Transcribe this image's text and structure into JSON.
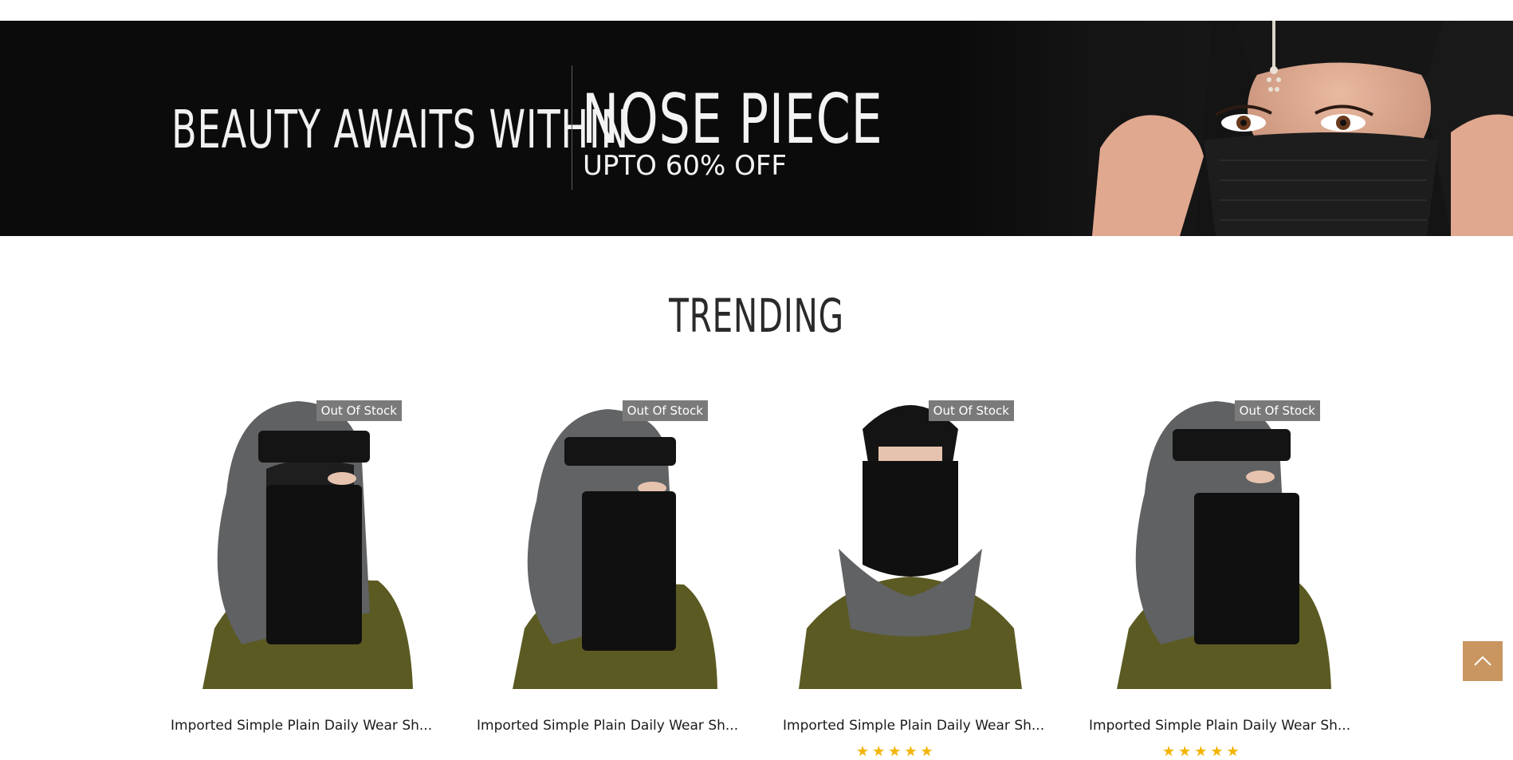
{
  "banner": {
    "tagline": "BEAUTY AWAITS WITHIN",
    "promo_title": "NOSE PIECE",
    "promo_subtitle": "UPTO 60% OFF"
  },
  "trending": {
    "title": "TRENDING",
    "products": [
      {
        "name": "Imported Simple Plain Daily Wear Sh...",
        "badge": "Out Of Stock",
        "stars": ""
      },
      {
        "name": "Imported Simple Plain Daily Wear Sh...",
        "badge": "Out Of Stock",
        "stars": ""
      },
      {
        "name": "Imported Simple Plain Daily Wear Sh...",
        "badge": "Out Of Stock",
        "stars": "★★★★★"
      },
      {
        "name": "Imported Simple Plain Daily Wear Sh...",
        "badge": "Out Of Stock",
        "stars": "★★★★★"
      }
    ]
  },
  "colors": {
    "banner_bg": "#0b0b0b",
    "badge_bg": "#7a7a7a",
    "accent": "#c99560",
    "star": "#f4b400"
  },
  "icons": {
    "back_to_top": "chevron-up-icon"
  }
}
